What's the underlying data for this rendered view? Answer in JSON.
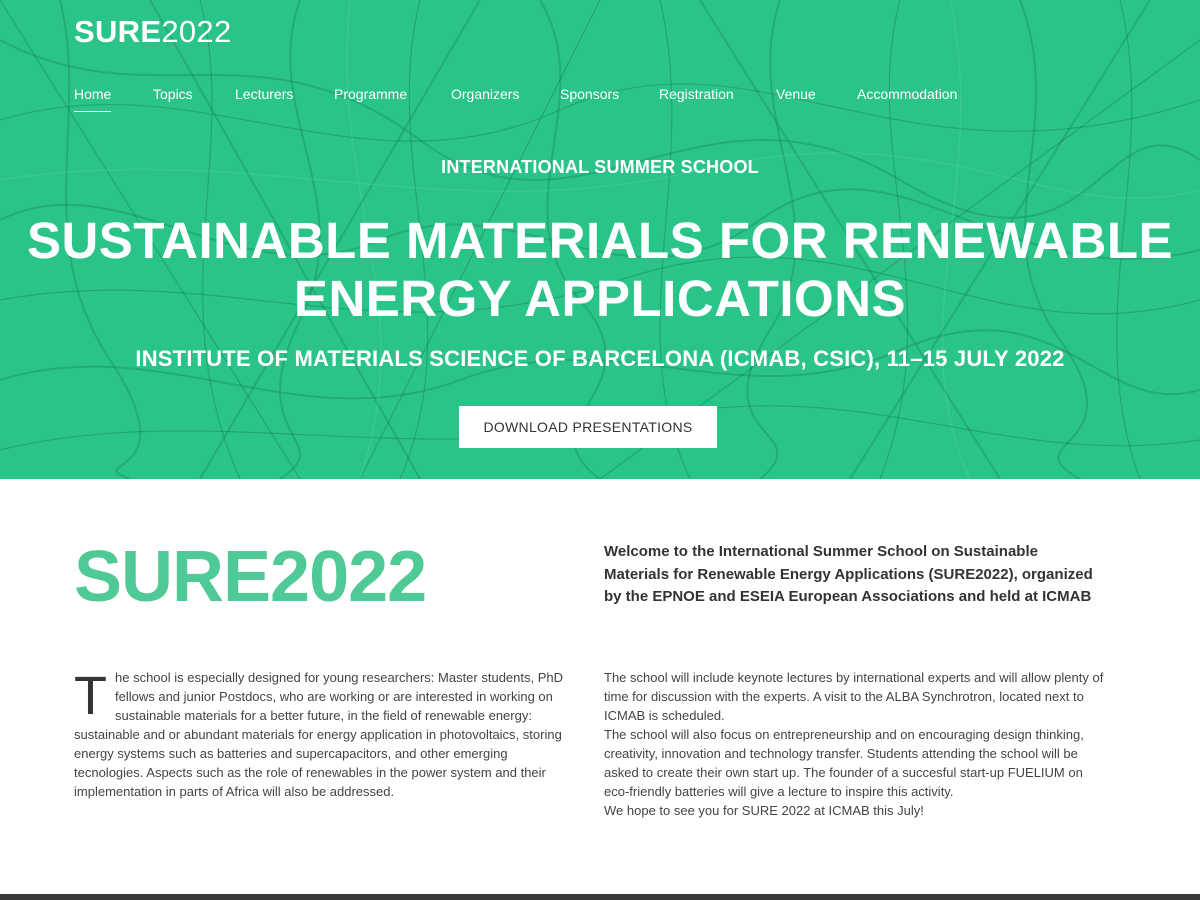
{
  "header": {
    "logo_bold": "SURE",
    "logo_light": "2022"
  },
  "nav": {
    "items": [
      {
        "label": "Home"
      },
      {
        "label": "Topics"
      },
      {
        "label": "Lecturers"
      },
      {
        "label": "Programme"
      },
      {
        "label": "Organizers"
      },
      {
        "label": "Sponsors"
      },
      {
        "label": "Registration"
      },
      {
        "label": "Venue"
      },
      {
        "label": "Accommodation"
      }
    ]
  },
  "hero": {
    "kicker": "INTERNATIONAL SUMMER SCHOOL",
    "headline_line1": "SUSTAINABLE MATERIALS FOR RENEWABLE",
    "headline_line2": "ENERGY APPLICATIONS",
    "subline": "INSTITUTE OF MATERIALS SCIENCE OF BARCELONA (ICMAB, CSIC), 11–15 JULY 2022",
    "cta_label": "DOWNLOAD PRESENTATIONS"
  },
  "intro": {
    "big_title": "SURE2022",
    "welcome": "Welcome to the International Summer School on Sustainable Materials for Renewable Energy Applications (SURE2022), organized by the EPNOE and ESEIA European Associations and held at ICMAB",
    "left_dropcap": "T",
    "left_text": "he school is especially designed for young researchers: Master students, PhD fellows and junior Postdocs, who are working or are interested in working on sustainable materials for a better future, in the field of renewable energy: sustainable and or abundant materials for energy application in photovoltaics, storing energy systems such as batteries and supercapacitors, and other emerging tecnologies. Aspects such as the role of renewables in the power system and their implementation in parts of Africa will also be addressed.",
    "right_p1": "The school will include keynote lectures by international experts and will allow plenty of time for discussion with the experts. A visit to the ALBA Synchrotron, located next to ICMAB is scheduled.",
    "right_p2": "The school will also focus on entrepreneurship and on encouraging design thinking, creativity, innovation and technology transfer. Students attending the school will be asked to create their own start up. The founder of a succesful start-up FUELIUM on eco-friendly batteries will give a lecture to inspire this activity.",
    "right_p3": "We hope to see you for SURE 2022 at ICMAB this July!"
  },
  "colors": {
    "hero_green": "#2ac489",
    "title_green": "#4fc995",
    "footer": "#3a3a3a"
  }
}
